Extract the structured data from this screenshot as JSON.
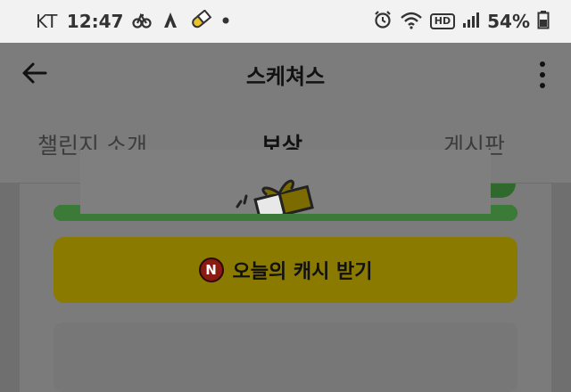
{
  "status_bar": {
    "carrier": "KT",
    "time": "12:47",
    "battery": "54%",
    "icons": [
      "bike-icon",
      "strava-icon",
      "pill-icon",
      "dot-icon",
      "alarm-icon",
      "wifi-icon",
      "hd-icon",
      "signal-icon",
      "battery-icon"
    ],
    "hd": "HD"
  },
  "header": {
    "title": "스케쳐스",
    "back_icon": "arrow-left-icon",
    "more_icon": "more-vertical-icon"
  },
  "tabs": [
    {
      "label": "챌린지 소개",
      "active": false
    },
    {
      "label": "보상",
      "active": true
    },
    {
      "label": "게시판",
      "active": false
    }
  ],
  "content": {
    "progress": 1.0,
    "cash_button": {
      "badge": "N",
      "label": "오늘의 캐시 받기"
    },
    "colors": {
      "progress_green": "#3c7a38",
      "cash_button_yellow": "#8a7a00",
      "badge_red": "#8a1a12"
    },
    "reward_image_icon": "gift-box-icon"
  }
}
